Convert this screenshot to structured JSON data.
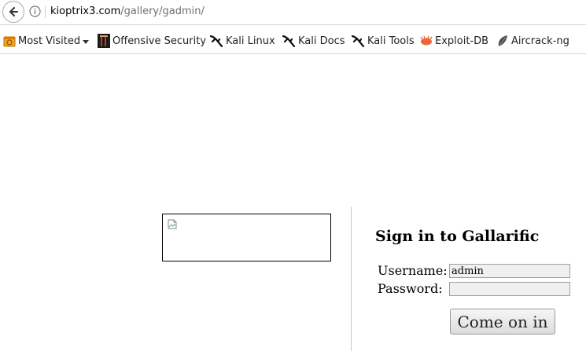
{
  "browser": {
    "url_host": "kioptrix3.com",
    "url_path": "/gallery/gadmin/",
    "icons": {
      "back": "back-arrow-icon",
      "info": "info-icon"
    }
  },
  "bookmarks": [
    {
      "label": "Most Visited",
      "icon": "most-visited-icon",
      "has_dropdown": true
    },
    {
      "label": "Offensive Security",
      "icon": "offensive-security-icon"
    },
    {
      "label": "Kali Linux",
      "icon": "kali-dragon-icon"
    },
    {
      "label": "Kali Docs",
      "icon": "kali-dragon-icon"
    },
    {
      "label": "Kali Tools",
      "icon": "kali-dragon-icon"
    },
    {
      "label": "Exploit-DB",
      "icon": "exploit-db-icon"
    },
    {
      "label": "Aircrack-ng",
      "icon": "aircrack-icon"
    }
  ],
  "login": {
    "title": "Sign in to Gallarific",
    "username_label": "Username:",
    "username_value": "admin",
    "password_label": "Password:",
    "password_value": "",
    "submit_label": "Come on in"
  },
  "colors": {
    "exploit_db_orange": "#e8663a",
    "field_bg": "#f0f0f0"
  }
}
